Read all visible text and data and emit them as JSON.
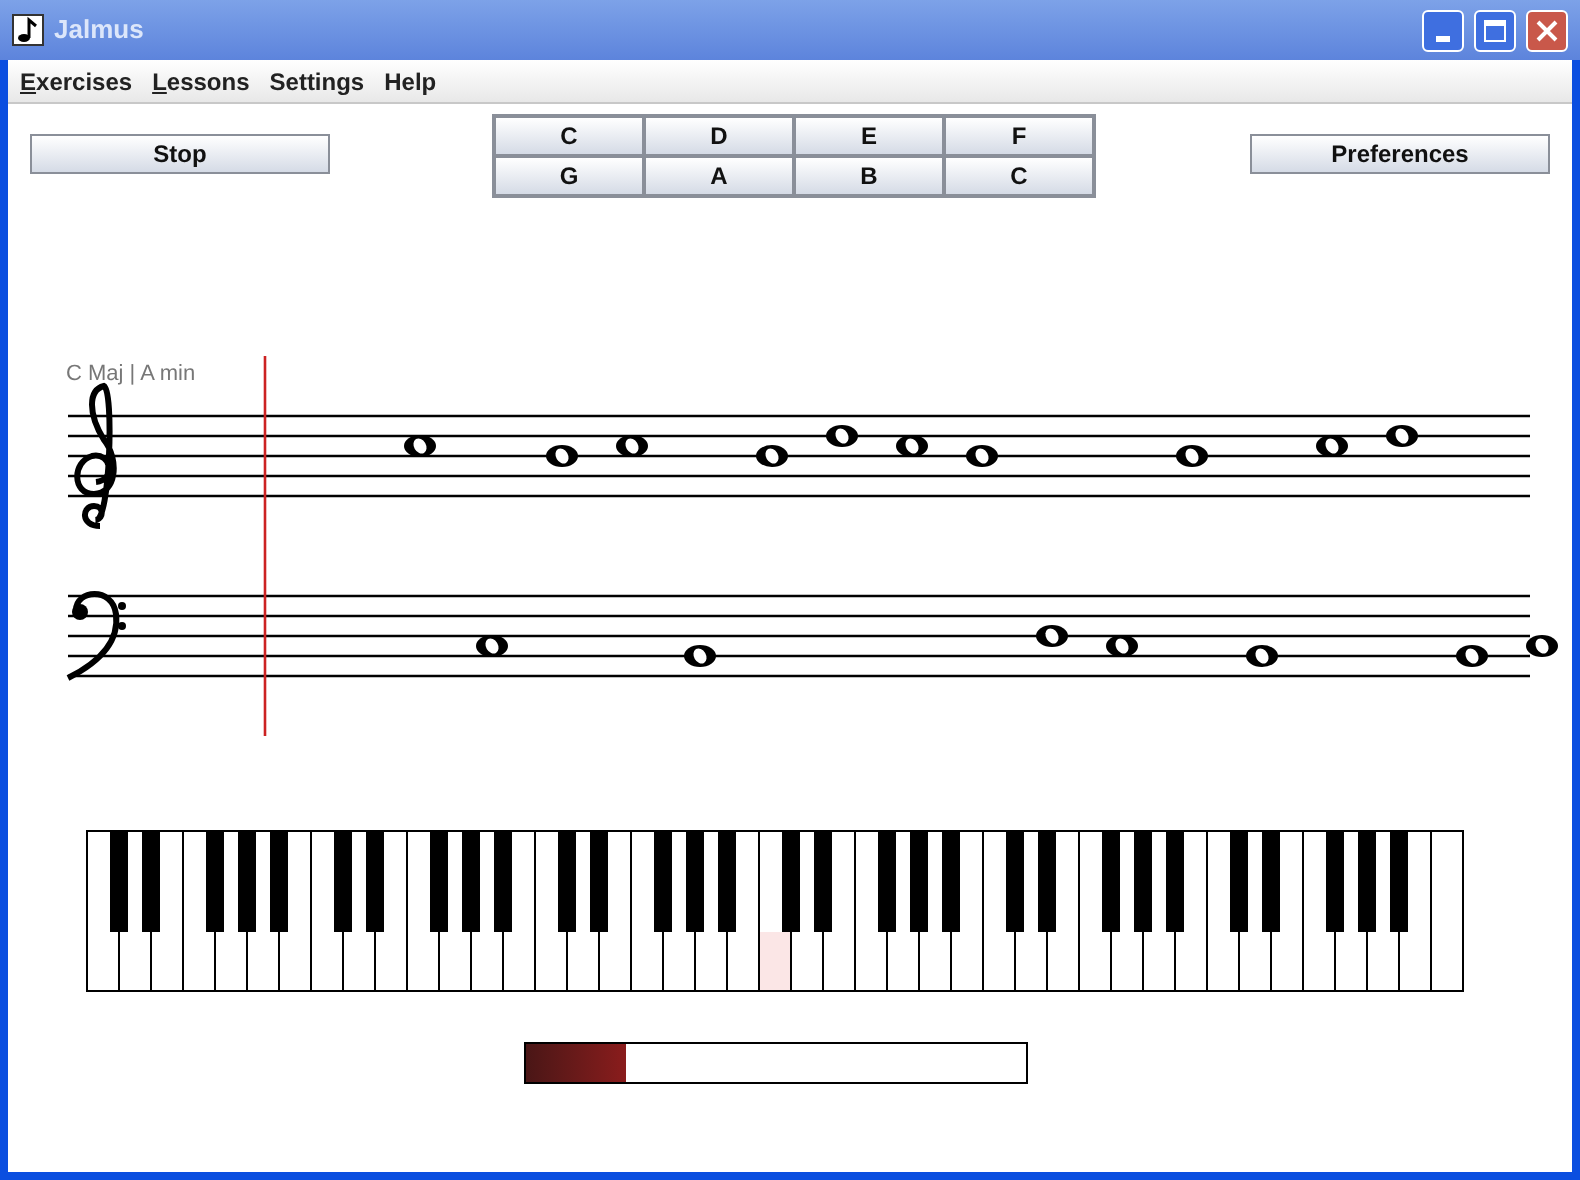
{
  "window": {
    "title": "Jalmus"
  },
  "menu": [
    {
      "label": "Exercises",
      "mnemonic": true
    },
    {
      "label": "Lessons",
      "mnemonic": true
    },
    {
      "label": "Settings",
      "mnemonic": false
    },
    {
      "label": "Help",
      "mnemonic": false
    }
  ],
  "stop_button": "Stop",
  "note_buttons": [
    "C",
    "D",
    "E",
    "F",
    "G",
    "A",
    "B",
    "C"
  ],
  "preferences_button": "Preferences",
  "key_signature": "C Maj | A min",
  "piano": {
    "white_keys": [
      {
        "pressed": false
      },
      {
        "pressed": false
      },
      {
        "pressed": false
      },
      {
        "pressed": false
      },
      {
        "pressed": false
      },
      {
        "pressed": false
      },
      {
        "pressed": false
      },
      {
        "pressed": false
      },
      {
        "pressed": false
      },
      {
        "pressed": false
      },
      {
        "pressed": false
      },
      {
        "pressed": false
      },
      {
        "pressed": false
      },
      {
        "pressed": false
      },
      {
        "pressed": false
      },
      {
        "pressed": false
      },
      {
        "pressed": false
      },
      {
        "pressed": false
      },
      {
        "pressed": false
      },
      {
        "pressed": false
      },
      {
        "pressed": false
      },
      {
        "pressed": true
      },
      {
        "pressed": false
      },
      {
        "pressed": false
      },
      {
        "pressed": false
      },
      {
        "pressed": false
      },
      {
        "pressed": false
      },
      {
        "pressed": false
      },
      {
        "pressed": false
      },
      {
        "pressed": false
      },
      {
        "pressed": false
      },
      {
        "pressed": false
      },
      {
        "pressed": false
      },
      {
        "pressed": false
      },
      {
        "pressed": false
      },
      {
        "pressed": false
      },
      {
        "pressed": false
      },
      {
        "pressed": false
      },
      {
        "pressed": false
      },
      {
        "pressed": false
      },
      {
        "pressed": false
      },
      {
        "pressed": false
      },
      {
        "pressed": false
      }
    ]
  },
  "progress": {
    "level": 0.2
  }
}
